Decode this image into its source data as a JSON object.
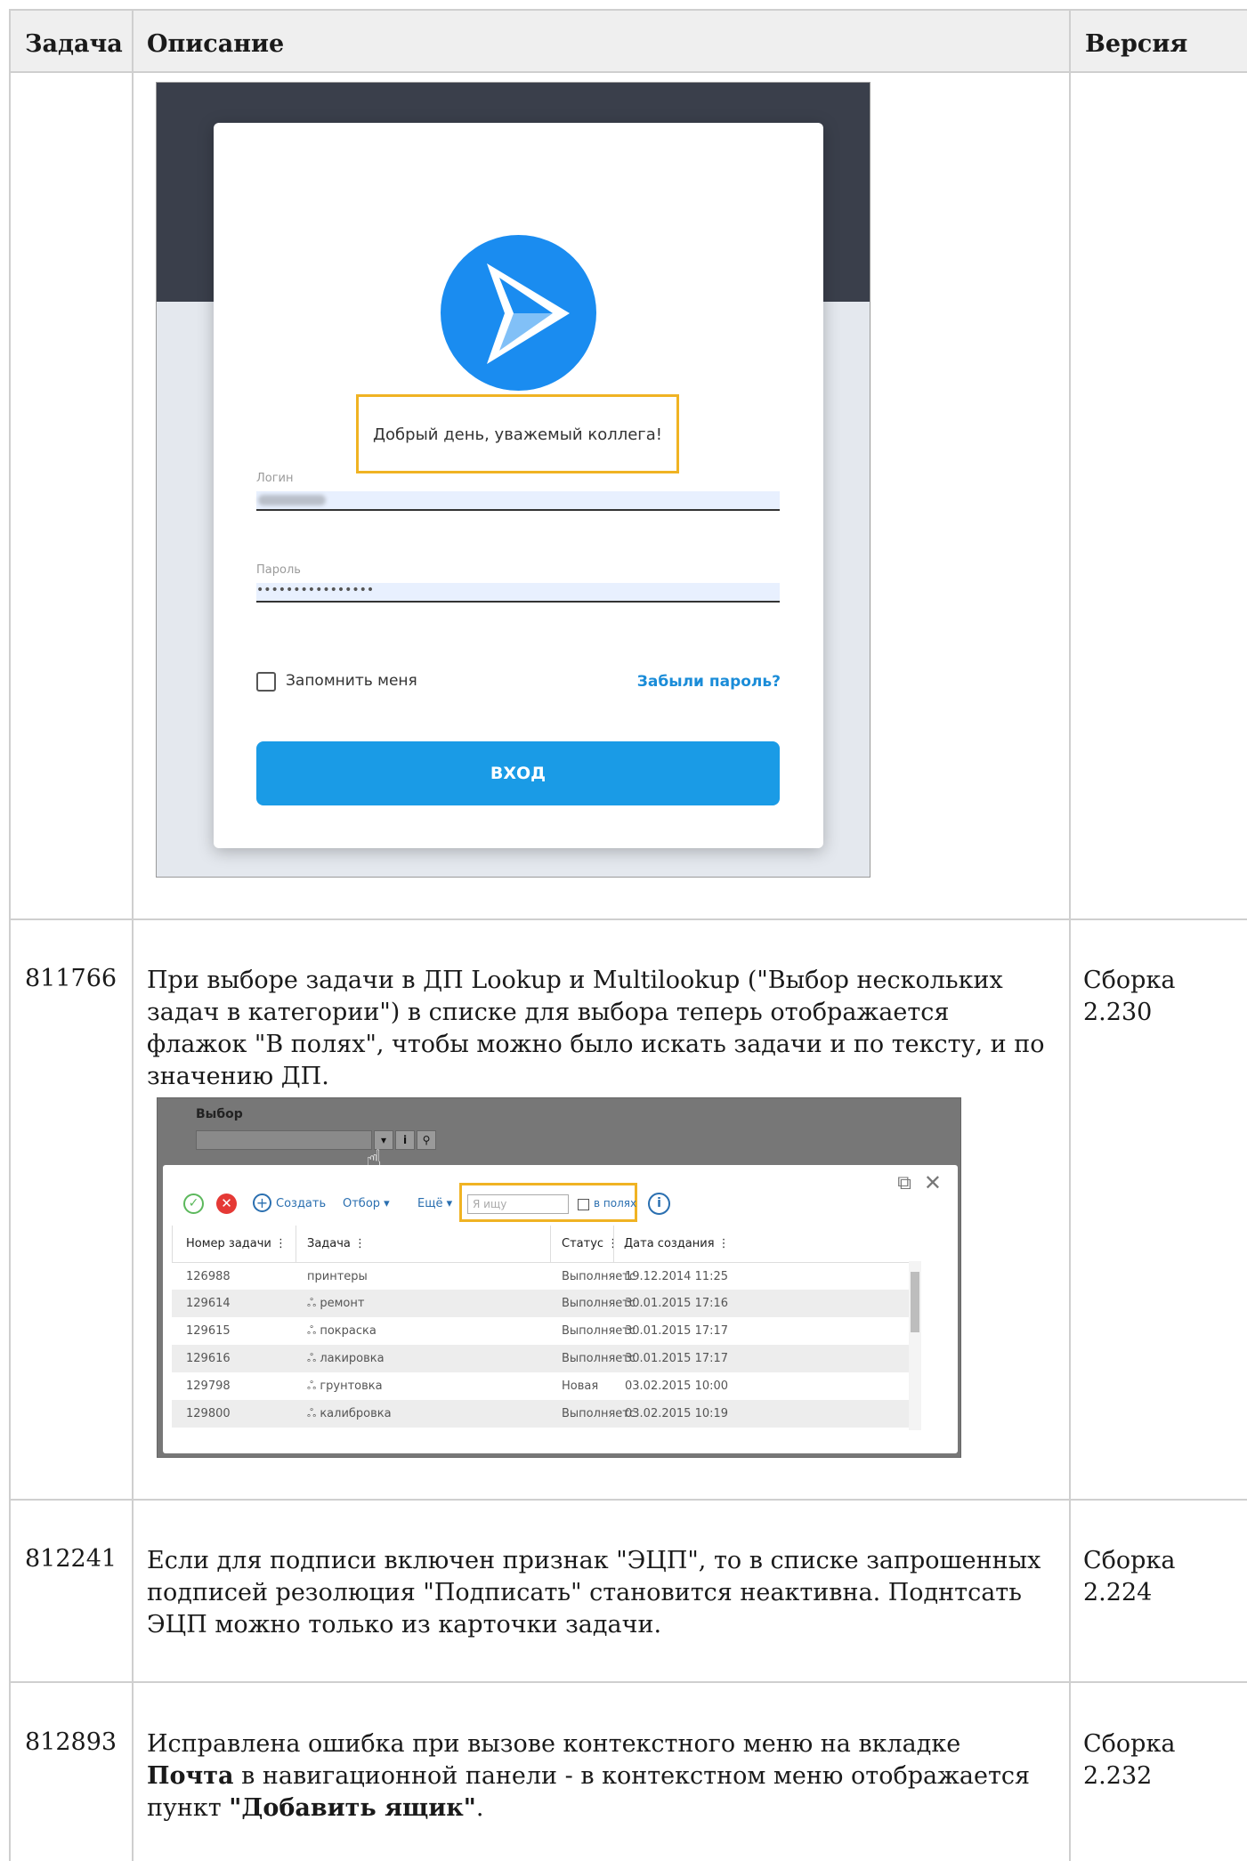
{
  "header": {
    "col_task": "Задача",
    "col_desc": "Описание",
    "col_version": "Версия"
  },
  "login_screenshot": {
    "greeting": "Добрый день, уважемый коллега!",
    "login_label": "Логин",
    "password_label": "Пароль",
    "password_value": "••••••••••••••••",
    "remember_label": "Запомнить меня",
    "forgot_label": "Забыли пароль?",
    "login_button": "ВХОД",
    "logo_icon": "play-arrow-icon",
    "accent_color": "#1a9be6",
    "highlight_color": "#f0b323"
  },
  "rows": [
    {
      "id": "811766",
      "description": "При выборе задачи в ДП Lookup и Multilookup (\"Выбор нескольких задач в категории\") в списке для выбора теперь отображается флажок \"В полях\", чтобы можно было искать задачи и по тексту, и по значению ДП.",
      "version": "Сборка 2.230"
    },
    {
      "id": "812241",
      "description": "Если для подписи включен признак \"ЭЦП\", то в списке запрошенных подписей резолюция \"Подписать\" становится неактивна. Поднтсать ЭЦП можно только из карточки задачи.",
      "version": "Сборка 2.224"
    },
    {
      "id": "812893",
      "desc_part1": "Исправлена ошибка при вызове контекстного меню на вкладке ",
      "desc_bold1": "Почта",
      "desc_part2": " в навигационной панели - в контекстном меню отображается пункт ",
      "desc_bold2": "\"Добавить ящик\"",
      "desc_part3": ".",
      "version": "Сборка 2.232"
    }
  ],
  "lookup_screenshot": {
    "field_label": "Выбор",
    "dropdown_btn": "▾",
    "info_btn": "i",
    "search_btn": "⚲",
    "toolbar": {
      "create": "Создать",
      "filter": "Отбор ▾",
      "more": "Ещё ▾"
    },
    "search_placeholder": "Я ищу",
    "in_fields_label": "в полях",
    "columns": [
      "Номер задачи ⋮",
      "Задача ⋮",
      "Статус ⋮",
      "Дата создания ⋮"
    ],
    "items": [
      {
        "num": "126988",
        "task": "принтеры",
        "status": "Выполняетс",
        "date": "19.12.2014 11:25"
      },
      {
        "num": "129614",
        "task": "ஃ ремонт",
        "status": "Выполняетс",
        "date": "30.01.2015 17:16"
      },
      {
        "num": "129615",
        "task": "ஃ покраска",
        "status": "Выполняетс",
        "date": "30.01.2015 17:17"
      },
      {
        "num": "129616",
        "task": "ஃ лакировка",
        "status": "Выполняетс",
        "date": "30.01.2015 17:17"
      },
      {
        "num": "129798",
        "task": "ஃ грунтовка",
        "status": "Новая",
        "date": "03.02.2015 10:00"
      },
      {
        "num": "129800",
        "task": "ஃ калибровка",
        "status": "Выполняетс",
        "date": "03.02.2015 10:19"
      }
    ]
  }
}
